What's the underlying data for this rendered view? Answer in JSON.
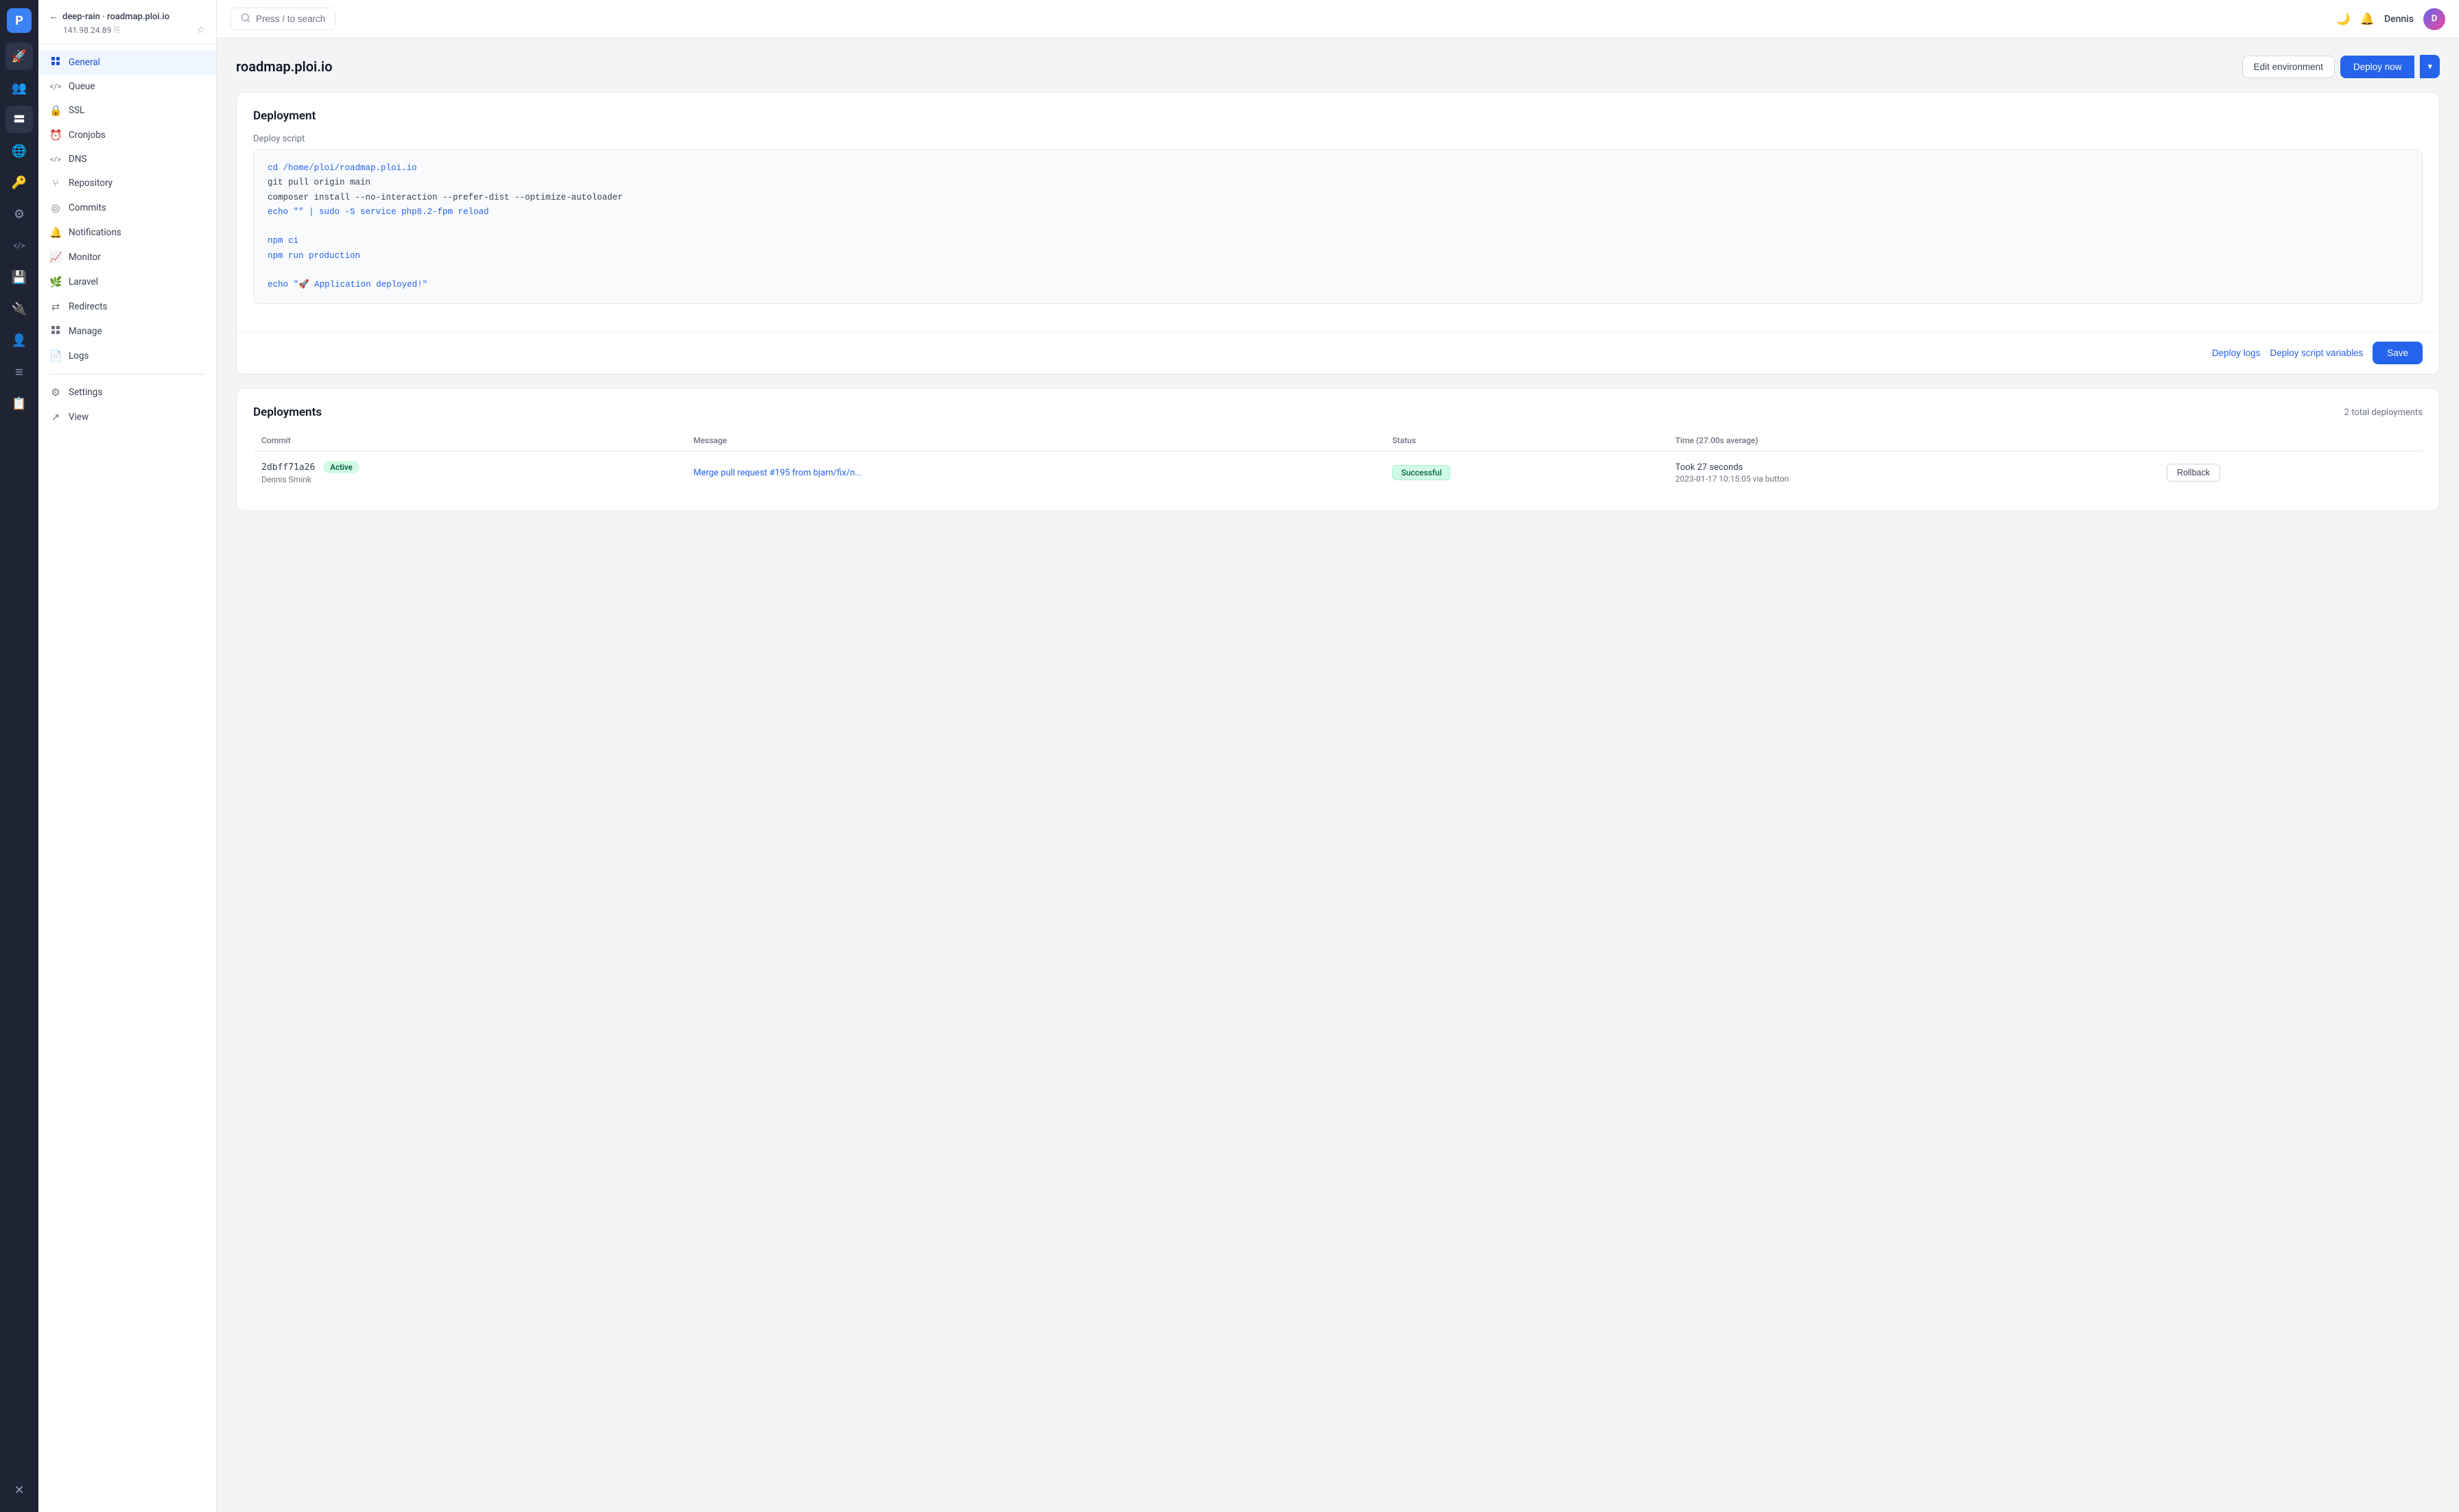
{
  "iconRail": {
    "logo": "P",
    "icons": [
      {
        "name": "rocket-icon",
        "symbol": "🚀"
      },
      {
        "name": "users-icon",
        "symbol": "👥"
      },
      {
        "name": "servers-icon",
        "symbol": "▦"
      },
      {
        "name": "globe-icon",
        "symbol": "🌐"
      },
      {
        "name": "key-icon",
        "symbol": "🔑"
      },
      {
        "name": "tools-icon",
        "symbol": "⚙"
      },
      {
        "name": "code-icon",
        "symbol": "</>"
      },
      {
        "name": "storage-icon",
        "symbol": "💾"
      },
      {
        "name": "plugin-icon",
        "symbol": "🔌"
      },
      {
        "name": "user-circle-icon",
        "symbol": "👤"
      },
      {
        "name": "list-icon",
        "symbol": "≡"
      },
      {
        "name": "note-icon",
        "symbol": "📋"
      },
      {
        "name": "close-circle-icon",
        "symbol": "✕"
      }
    ]
  },
  "sidebar": {
    "backLabel": "deep-rain · roadmap.ploi.io",
    "ip": "141.98.24.89",
    "navItems": [
      {
        "id": "general",
        "label": "General",
        "icon": "■",
        "active": true
      },
      {
        "id": "queue",
        "label": "Queue",
        "icon": "</>"
      },
      {
        "id": "ssl",
        "label": "SSL",
        "icon": "🔒"
      },
      {
        "id": "cronjobs",
        "label": "Cronjobs",
        "icon": "⏰"
      },
      {
        "id": "dns",
        "label": "DNS",
        "icon": "</>"
      },
      {
        "id": "repository",
        "label": "Repository",
        "icon": "⑂"
      },
      {
        "id": "commits",
        "label": "Commits",
        "icon": "⊙"
      },
      {
        "id": "notifications",
        "label": "Notifications",
        "icon": "🔔"
      },
      {
        "id": "monitor",
        "label": "Monitor",
        "icon": "📈"
      },
      {
        "id": "laravel",
        "label": "Laravel",
        "icon": "🌿"
      },
      {
        "id": "redirects",
        "label": "Redirects",
        "icon": "⇄"
      },
      {
        "id": "manage",
        "label": "Manage",
        "icon": "▦"
      },
      {
        "id": "logs",
        "label": "Logs",
        "icon": "📄"
      },
      {
        "id": "settings",
        "label": "Settings",
        "icon": "⚙"
      },
      {
        "id": "view",
        "label": "View",
        "icon": "↗"
      }
    ]
  },
  "topbar": {
    "searchPlaceholder": "Press / to search",
    "searchSlash": "/",
    "moonIcon": "🌙",
    "bellIcon": "🔔",
    "username": "Dennis"
  },
  "page": {
    "title": "roadmap.ploi.io",
    "editEnvLabel": "Edit environment",
    "deployNowLabel": "Deploy now"
  },
  "deployment": {
    "sectionTitle": "Deployment",
    "scriptLabel": "Deploy script",
    "codeLines": [
      {
        "text": "cd /home/ploi/roadmap.ploi.io",
        "colored": true
      },
      {
        "text": "git pull origin main",
        "colored": false
      },
      {
        "text": "composer install --no-interaction --prefer-dist --optimize-autoloader",
        "colored": false
      },
      {
        "text": "echo \"\" | sudo -S service php8.2-fpm reload",
        "colored": true
      },
      {
        "text": "",
        "colored": false
      },
      {
        "text": "npm ci",
        "colored": true
      },
      {
        "text": "npm run production",
        "colored": true
      },
      {
        "text": "",
        "colored": false
      },
      {
        "text": "echo \"🚀 Application deployed!\"",
        "colored": true
      }
    ],
    "deployLogsLabel": "Deploy logs",
    "deployScriptVarsLabel": "Deploy script variables",
    "saveLabel": "Save"
  },
  "deploymentsSection": {
    "title": "Deployments",
    "totalLabel": "2 total deployments",
    "columns": [
      "Commit",
      "Message",
      "Status",
      "Time (27.00s average)"
    ],
    "rows": [
      {
        "hash": "2dbff71a26",
        "active": true,
        "activeLabel": "Active",
        "author": "Dennis Smink",
        "message": "Merge pull request #195 from bjarn/fix/n...",
        "status": "Successful",
        "timeTook": "Took 27 seconds",
        "timeDetail": "2023-01-17 10:15:05 via button",
        "rollbackLabel": "Rollback"
      }
    ]
  }
}
